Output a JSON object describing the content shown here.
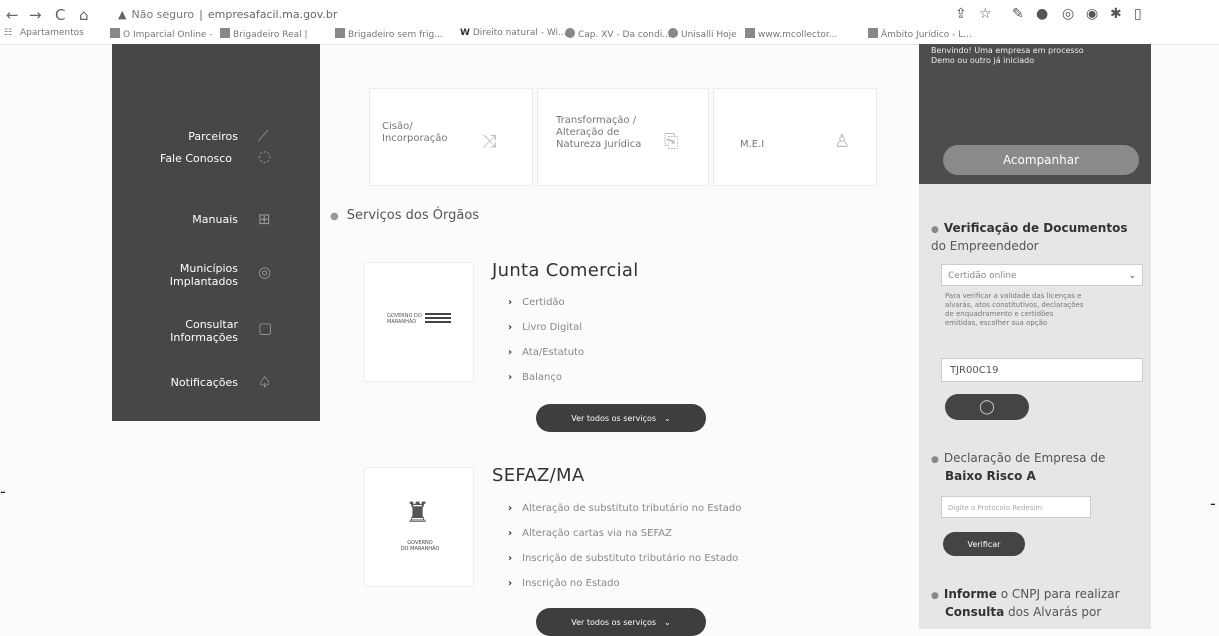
{
  "browser": {
    "back": "←",
    "forward": "→",
    "reload": "C",
    "home": "⌂",
    "security": "Não seguro",
    "url": "empresafacil.ma.gov.br",
    "bookmarks": [
      "Apartamentos",
      "O Imparcial Online -",
      "Brigadeiro Real |",
      "Brigadeiro sem frig...",
      "Direito natural - Wi...",
      "Cap. XV - Da condi...",
      "Unisalli Hoje",
      "www.mcollector...",
      "Âmbito Jurídico - L..."
    ]
  },
  "sidebar": {
    "items": [
      {
        "label": "Parceiros",
        "icon": "handshake-icon"
      },
      {
        "label": "Fale Conosco",
        "icon": "chat-icon"
      },
      {
        "label": "Manuais",
        "icon": "manual-icon"
      },
      {
        "label": "Municípios\nImplantados",
        "icon": "location-icon"
      },
      {
        "label": "Consultar\nInformações",
        "icon": "info-icon"
      },
      {
        "label": "Notificações",
        "icon": "bell-icon"
      }
    ]
  },
  "top_cards": [
    {
      "label": "Cisão/\nIncorporação",
      "icon": "split-icon"
    },
    {
      "label": "Transformação /\nAlteração de\nNatureza Jurídica",
      "icon": "transform-icon"
    },
    {
      "label": "M.E.I",
      "icon": "person-icon"
    }
  ],
  "section_title": "Serviços dos Órgãos",
  "orgs": [
    {
      "name": "Junta Comercial",
      "logo_text": "GOVERNO DO\nMARANHÃO",
      "services": [
        "Certidão",
        "Livro Digital",
        "Ata/Estatuto",
        "Balanço"
      ],
      "button": "Ver todos os serviços"
    },
    {
      "name": "SEFAZ/MA",
      "logo_text": "GOVERNO\nDO MARANHÃO",
      "services": [
        "Alteração de substituto tributário no Estado",
        "Alteração cartas via na SEFAZ",
        "Inscrição de substituto tributário no Estado",
        "Inscrição no Estado"
      ],
      "button": "Ver todos os serviços"
    }
  ],
  "right_panel": {
    "top_text": "Benvindo! Uma empresa em processo\nDemo ou outro já iniciado",
    "follow_button": "Acompanhar",
    "verify_title_bold": "Verificação de Documentos",
    "verify_title_rest": " do Empreendedor",
    "verify_select": "Certidão online",
    "verify_help": "Para verificar a validade das licenças e\nalvarás, atos constitutivos, declarações\nde enquadramento e certidões\nemitidas, escolher sua opção",
    "verify_code": "TJR00C19",
    "decl_title_rest": "Declaração de Empresa de",
    "decl_title_bold": "Baixo Risco A",
    "decl_placeholder": "Digite o Protocolo Redesim",
    "decl_button": "Verificar",
    "inform_bold1": "Informe",
    "inform_rest1": " o CNPJ para realizar",
    "inform_bold2": "Consulta",
    "inform_rest2": " dos Alvarás por"
  }
}
